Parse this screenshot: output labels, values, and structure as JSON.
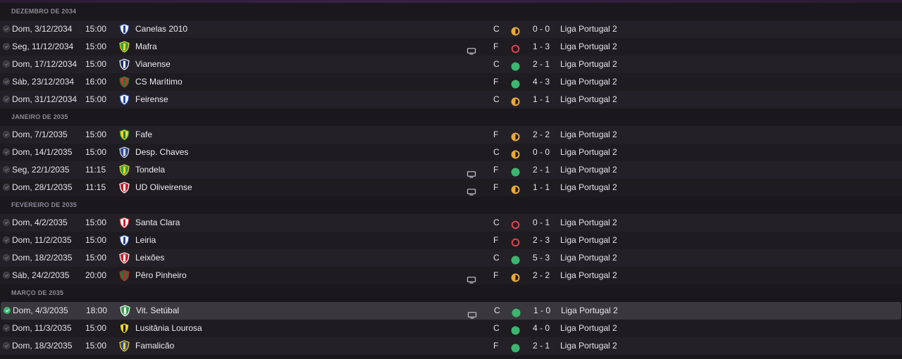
{
  "months": [
    {
      "label": "DEZEMBRO DE 2034",
      "matches": [
        {
          "date": "Dom, 3/12/2034",
          "time": "15:00",
          "team": "Canelas 2010",
          "crest": "canelas",
          "tv": false,
          "venue": "C",
          "result": "draw",
          "score": "0 - 0",
          "competition": "Liga Portugal 2"
        },
        {
          "date": "Seg, 11/12/2034",
          "time": "15:00",
          "team": "Mafra",
          "crest": "mafra",
          "tv": true,
          "venue": "F",
          "result": "loss",
          "score": "1 - 3",
          "competition": "Liga Portugal 2"
        },
        {
          "date": "Dom, 17/12/2034",
          "time": "15:00",
          "team": "Vianense",
          "crest": "vianense",
          "tv": false,
          "venue": "C",
          "result": "win",
          "score": "2 - 1",
          "competition": "Liga Portugal 2"
        },
        {
          "date": "Sáb, 23/12/2034",
          "time": "16:00",
          "team": "CS Marítimo",
          "crest": "maritimo",
          "tv": false,
          "venue": "F",
          "result": "win",
          "score": "4 - 3",
          "competition": "Liga Portugal 2"
        },
        {
          "date": "Dom, 31/12/2034",
          "time": "15:00",
          "team": "Feirense",
          "crest": "feirense",
          "tv": false,
          "venue": "C",
          "result": "draw",
          "score": "1 - 1",
          "competition": "Liga Portugal 2"
        }
      ]
    },
    {
      "label": "JANEIRO DE 2035",
      "matches": [
        {
          "date": "Dom, 7/1/2035",
          "time": "15:00",
          "team": "Fafe",
          "crest": "fafe",
          "tv": false,
          "venue": "F",
          "result": "draw",
          "score": "2 - 2",
          "competition": "Liga Portugal 2"
        },
        {
          "date": "Dom, 14/1/2035",
          "time": "15:00",
          "team": "Desp. Chaves",
          "crest": "chaves",
          "tv": false,
          "venue": "C",
          "result": "draw",
          "score": "0 - 0",
          "competition": "Liga Portugal 2"
        },
        {
          "date": "Seg, 22/1/2035",
          "time": "11:15",
          "team": "Tondela",
          "crest": "tondela",
          "tv": true,
          "venue": "F",
          "result": "win",
          "score": "2 - 1",
          "competition": "Liga Portugal 2"
        },
        {
          "date": "Dom, 28/1/2035",
          "time": "11:15",
          "team": "UD Oliveirense",
          "crest": "oliveirense",
          "tv": true,
          "venue": "F",
          "result": "draw",
          "score": "1 - 1",
          "competition": "Liga Portugal 2"
        }
      ]
    },
    {
      "label": "FEVEREIRO DE 2035",
      "matches": [
        {
          "date": "Dom, 4/2/2035",
          "time": "15:00",
          "team": "Santa Clara",
          "crest": "santaclara",
          "tv": false,
          "venue": "C",
          "result": "loss",
          "score": "0 - 1",
          "competition": "Liga Portugal 2"
        },
        {
          "date": "Dom, 11/2/2035",
          "time": "15:00",
          "team": "Leiria",
          "crest": "leiria",
          "tv": false,
          "venue": "F",
          "result": "loss",
          "score": "2 - 3",
          "competition": "Liga Portugal 2"
        },
        {
          "date": "Dom, 18/2/2035",
          "time": "15:00",
          "team": "Leixões",
          "crest": "leixoes",
          "tv": false,
          "venue": "C",
          "result": "win",
          "score": "5 - 3",
          "competition": "Liga Portugal 2"
        },
        {
          "date": "Sáb, 24/2/2035",
          "time": "20:00",
          "team": "Pêro Pinheiro",
          "crest": "peropinheiro",
          "tv": true,
          "venue": "F",
          "result": "draw",
          "score": "2 - 2",
          "competition": "Liga Portugal 2"
        }
      ]
    },
    {
      "label": "MARÇO DE 2035",
      "matches": [
        {
          "date": "Dom, 4/3/2035",
          "time": "18:00",
          "team": "Vit. Setúbal",
          "crest": "setubal",
          "tv": true,
          "venue": "C",
          "result": "win",
          "score": "1 - 0",
          "competition": "Liga Portugal 2",
          "selected": true
        },
        {
          "date": "Dom, 11/3/2035",
          "time": "15:00",
          "team": "Lusitânia Lourosa",
          "crest": "lourosa",
          "tv": false,
          "venue": "C",
          "result": "win",
          "score": "4 - 0",
          "competition": "Liga Portugal 2"
        },
        {
          "date": "Dom, 18/3/2035",
          "time": "15:00",
          "team": "Famalicão",
          "crest": "famalicao",
          "tv": false,
          "venue": "F",
          "result": "win",
          "score": "2 - 1",
          "competition": "Liga Portugal 2"
        }
      ]
    }
  ],
  "colors": {
    "win": "#3cb66f",
    "loss": "#d8434f",
    "draw": "#e8a93a",
    "accent": "#3a2147"
  },
  "crests": {
    "canelas": {
      "c1": "#f0f0f0",
      "c2": "#1f3d8a"
    },
    "mafra": {
      "c1": "#2ea043",
      "c2": "#f5d32a"
    },
    "vianense": {
      "c1": "#1d2a6a",
      "c2": "#ffffff"
    },
    "maritimo": {
      "c1": "#c53a28",
      "c2": "#1c7a36"
    },
    "feirense": {
      "c1": "#ffffff",
      "c2": "#1f4aa8"
    },
    "fafe": {
      "c1": "#f0d81e",
      "c2": "#1f7a3a"
    },
    "chaves": {
      "c1": "#2b4a9c",
      "c2": "#d9d9d9"
    },
    "tondela": {
      "c1": "#2ea043",
      "c2": "#f5d32a"
    },
    "oliveirense": {
      "c1": "#c8202a",
      "c2": "#ffffff"
    },
    "santaclara": {
      "c1": "#ffffff",
      "c2": "#c8202a"
    },
    "leiria": {
      "c1": "#ffffff",
      "c2": "#1f3d8a"
    },
    "leixoes": {
      "c1": "#c8202a",
      "c2": "#ffffff"
    },
    "peropinheiro": {
      "c1": "#1c7a36",
      "c2": "#c8202a"
    },
    "setubal": {
      "c1": "#2ea043",
      "c2": "#ffffff"
    },
    "lourosa": {
      "c1": "#f5d32a",
      "c2": "#111111"
    },
    "famalicao": {
      "c1": "#2b4a9c",
      "c2": "#f5d32a"
    }
  }
}
